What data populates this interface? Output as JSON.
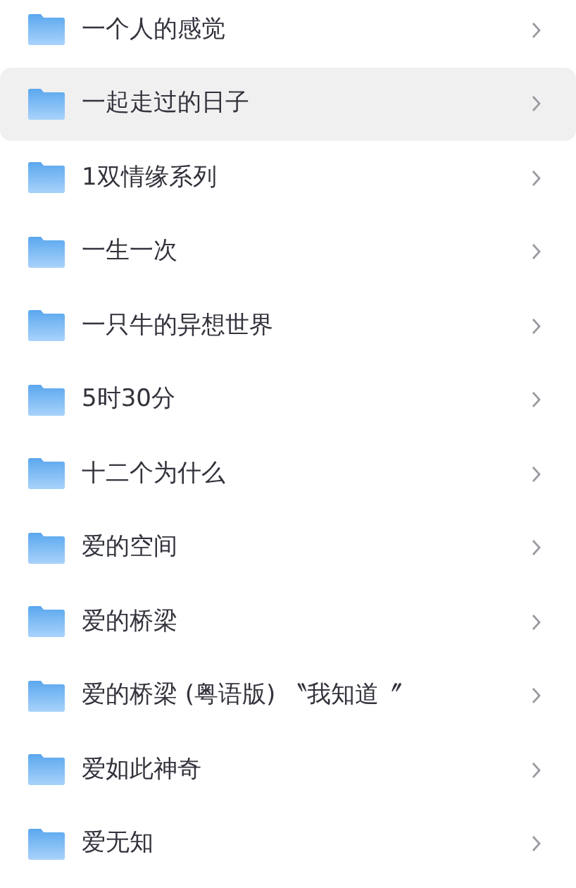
{
  "folders": [
    {
      "name": "一个人的感觉",
      "selected": false
    },
    {
      "name": "一起走过的日子",
      "selected": true
    },
    {
      "name": "1双情缘系列",
      "selected": false
    },
    {
      "name": "一生一次",
      "selected": false
    },
    {
      "name": "一只牛的异想世界",
      "selected": false
    },
    {
      "name": "5时30分",
      "selected": false
    },
    {
      "name": "十二个为什么",
      "selected": false
    },
    {
      "name": "爱的空间",
      "selected": false
    },
    {
      "name": "爱的桥梁",
      "selected": false
    },
    {
      "name": "爱的桥梁 (粤语版) 〝我知道〞",
      "selected": false
    },
    {
      "name": "爱如此神奇",
      "selected": false
    },
    {
      "name": "爱无知",
      "selected": false
    }
  ]
}
